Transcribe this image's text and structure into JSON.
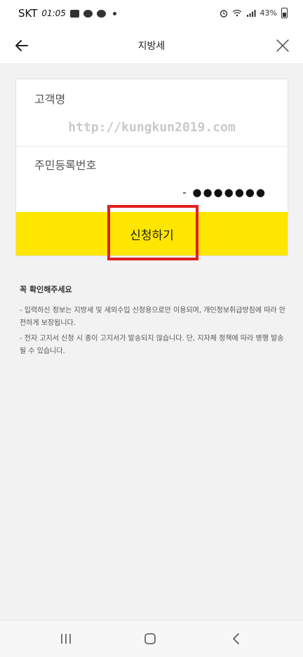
{
  "status_bar": {
    "carrier": "SKT",
    "time": "01:05",
    "battery": "43%"
  },
  "app_bar": {
    "title": "지방세",
    "back_icon": "arrow-left-icon",
    "close_icon": "close-icon"
  },
  "form": {
    "name_label": "고객명",
    "watermark": "http://kungkun2019.com",
    "rrn_label": "주민등록번호",
    "rrn_value": "- ●●●●●●●",
    "apply_label": "신청하기"
  },
  "notice": {
    "title": "꼭 확인해주세요",
    "lines": [
      "- 입력하신 정보는 지방세 및 세외수입 신청용으로만 이용되며, 개인정보취급방침에 따라 안전하게 보장됩니다.",
      "- 전자 고지서 신청 시 종이 고지서가 발송되지 않습니다. 단, 지자체 정책에 따라 병행 발송될 수 있습니다."
    ]
  },
  "colors": {
    "accent": "#ffe600",
    "highlight": "#e02020"
  }
}
